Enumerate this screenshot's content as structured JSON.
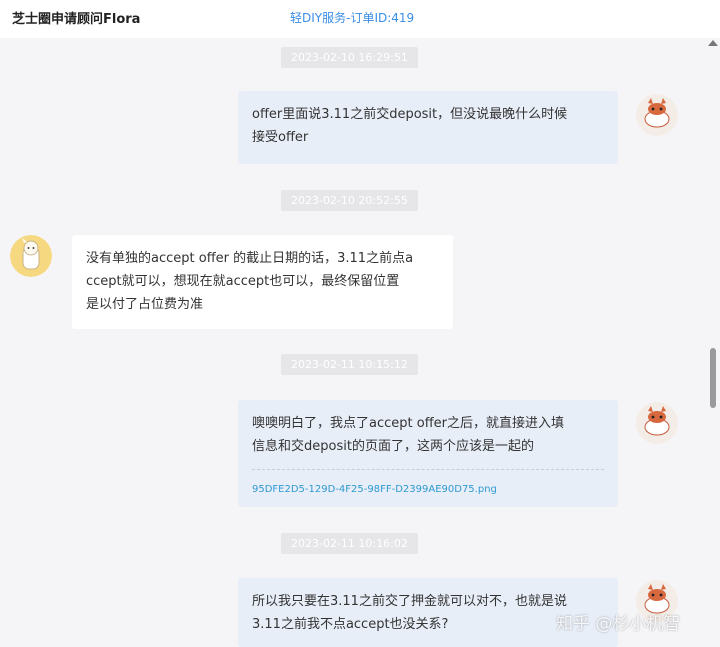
{
  "header": {
    "title": "芝士圈申请顾问Flora",
    "order": "轻DIY服务-订单ID:419"
  },
  "messages": [
    {
      "time": "2023-02-10 16:29:51",
      "side": "right",
      "lines": [
        "offer里面说3.11之前交deposit，但没说最晚什么时候",
        "接受offer"
      ]
    },
    {
      "time": "2023-02-10 20:52:55",
      "side": "left",
      "lines": [
        "没有单独的accept offer 的截止日期的话，3.11之前点a",
        "ccept就可以，想现在就accept也可以，最终保留位置",
        "是以付了占位费为准"
      ]
    },
    {
      "time": "2023-02-11 10:15:12",
      "side": "right",
      "lines": [
        "噢噢明白了，我点了accept offer之后，就直接进入填",
        "信息和交deposit的页面了，这两个应该是一起的"
      ],
      "attachment": "95DFE2D5-129D-4F25-98FF-D2399AE90D75.png"
    },
    {
      "time": "2023-02-11 10:16:02",
      "side": "right",
      "lines": [
        "所以我只要在3.11之前交了押金就可以对不，也就是说",
        "3.11之前我不点accept也没关系?"
      ]
    }
  ],
  "watermark": "知乎 @杉小机智"
}
